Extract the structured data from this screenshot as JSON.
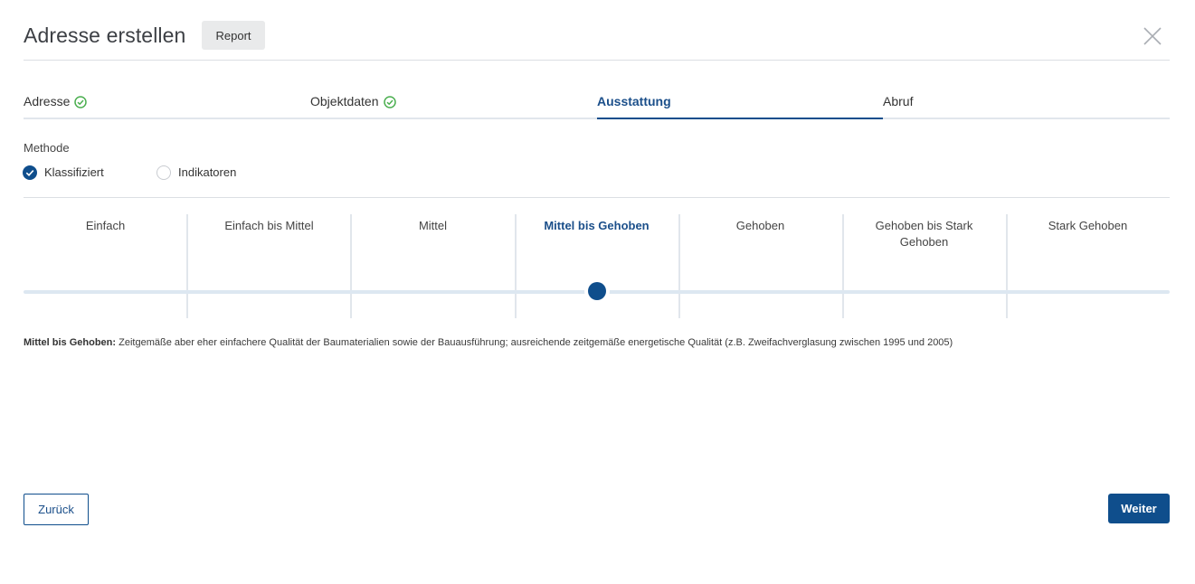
{
  "header": {
    "title": "Adresse erstellen",
    "report_label": "Report",
    "close_icon": "close-icon"
  },
  "steps": [
    {
      "label": "Adresse",
      "done": true,
      "active": false
    },
    {
      "label": "Objektdaten",
      "done": true,
      "active": false
    },
    {
      "label": "Ausstattung",
      "done": false,
      "active": true
    },
    {
      "label": "Abruf",
      "done": false,
      "active": false
    }
  ],
  "method": {
    "label": "Methode",
    "options": [
      {
        "label": "Klassifiziert",
        "checked": true
      },
      {
        "label": "Indikatoren",
        "checked": false
      }
    ]
  },
  "scale": {
    "levels": [
      "Einfach",
      "Einfach bis Mittel",
      "Mittel",
      "Mittel bis Gehoben",
      "Gehoben",
      "Gehoben bis Stark Gehoben",
      "Stark Gehoben"
    ],
    "selected_index": 3
  },
  "description": {
    "title": "Mittel bis Gehoben:",
    "text": " Zeitgemäße aber eher einfachere Qualität der Baumaterialien sowie der Bauausführung; ausreichende zeitgemäße energetische Qualität (z.B. Zweifachverglasung zwischen 1995 und 2005)"
  },
  "footer": {
    "back_label": "Zurück",
    "next_label": "Weiter"
  },
  "colors": {
    "primary": "#0f4e8c",
    "success": "#4caf50",
    "track": "#dde7f1"
  }
}
